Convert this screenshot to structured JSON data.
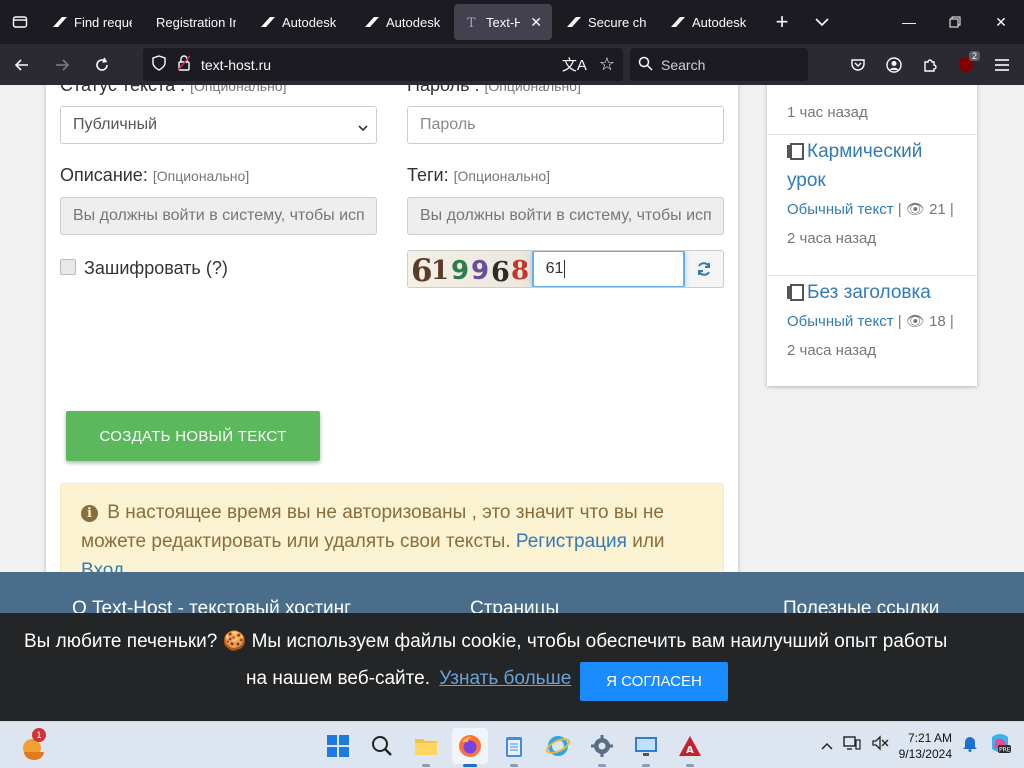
{
  "browser": {
    "tabs": [
      {
        "title": "Find reque",
        "icon": "autodesk-icon"
      },
      {
        "title": "Registration Inf",
        "icon": "none"
      },
      {
        "title": "Autodesk -",
        "icon": "autodesk-icon"
      },
      {
        "title": "Autodesk -",
        "icon": "autodesk-icon"
      },
      {
        "title": "Text-Ho",
        "icon": "text-host-icon",
        "active": true
      },
      {
        "title": "Secure che",
        "icon": "autodesk-icon"
      },
      {
        "title": "Autodesk |",
        "icon": "autodesk-icon"
      }
    ],
    "url": "text-host.ru",
    "search_placeholder": "Search",
    "extension_badge": "2"
  },
  "form": {
    "status_label": "Статус текста :",
    "status_optional": "[Опционально]",
    "status_value": "Публичный",
    "password_label": "Пароль :",
    "password_optional": "[Опционально]",
    "password_placeholder": "Пароль",
    "description_label": "Описание:",
    "description_optional": "[Опционально]",
    "description_placeholder": "Вы должны войти в систему, чтобы исп",
    "tags_label": "Теги:",
    "tags_optional": "[Опционально]",
    "tags_placeholder": "Вы должны войти в систему, чтобы исп",
    "encrypt_label": "Зашифровать",
    "encrypt_help": "(?)",
    "captcha_image_text": "619968",
    "captcha_value": "61",
    "create_button": "Создать новый текст"
  },
  "alert": {
    "text": "В настоящее время вы не авторизованы , это значит что вы не можете редактировать или удалять свои тексты.",
    "register_link": "Регистрация",
    "or": "или",
    "login_link": "Вход"
  },
  "sidebar": {
    "top_time": "1 час назад",
    "items": [
      {
        "title": "Кармический урок",
        "type": "Обычный текст",
        "views": "21",
        "time": "2 часа назад"
      },
      {
        "title": "Без заголовка",
        "type": "Обычный текст",
        "views": "18",
        "time": "2 часа назад"
      }
    ]
  },
  "footer": {
    "col1": "О Text-Host - текстовый хостинг",
    "col2": "Страницы",
    "col3": "Полезные ссылки"
  },
  "cookie": {
    "line1": "Вы любите печеньки? 🍪 Мы используем файлы cookie, чтобы обеспечить вам наилучший опыт работы",
    "line2": "на нашем веб-сайте.",
    "learn_more": "Узнать больше",
    "agree_button": "Я согласен"
  },
  "taskbar": {
    "time": "7:21 AM",
    "date": "9/13/2024",
    "widget_badge": "1"
  }
}
